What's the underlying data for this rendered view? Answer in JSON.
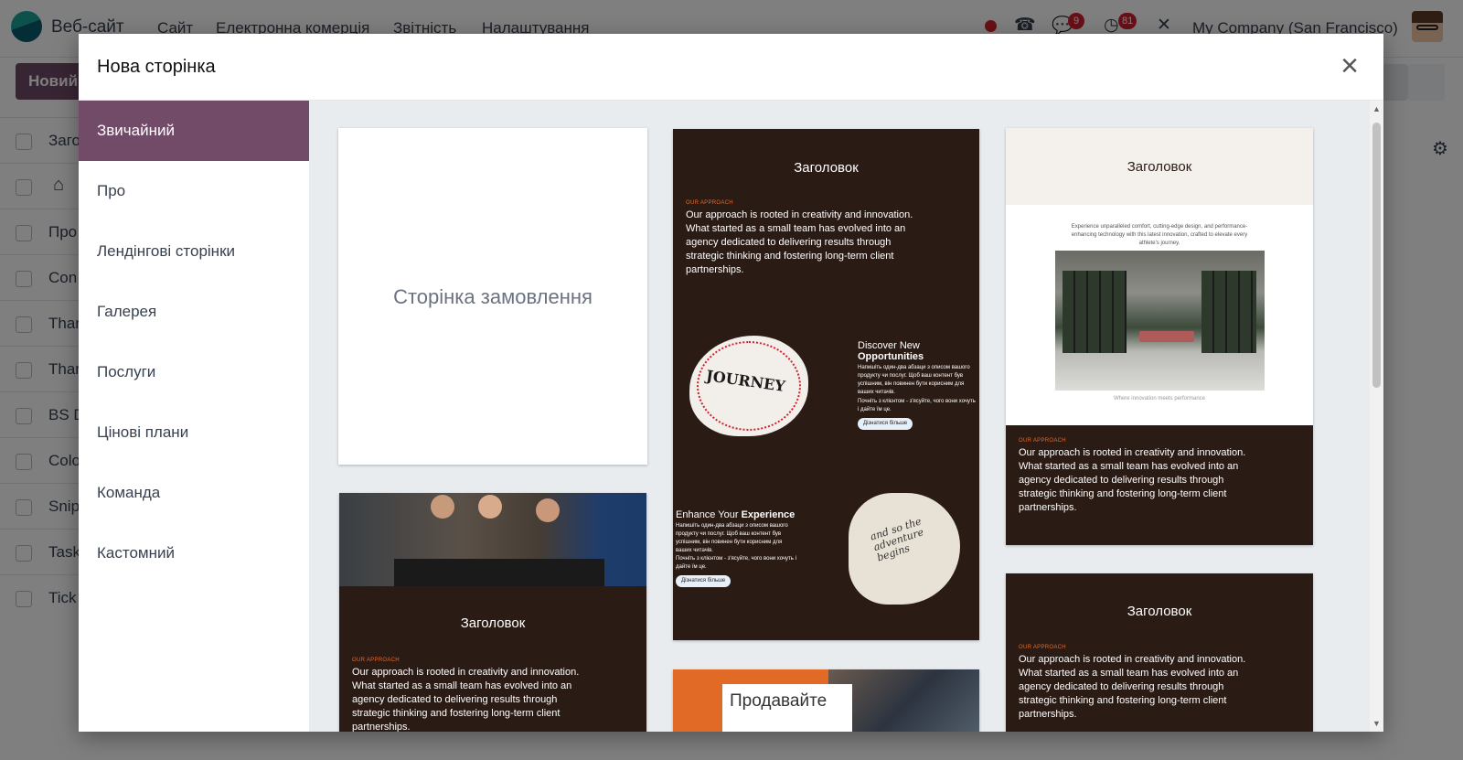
{
  "app": {
    "name": "Веб-сайт",
    "menu": [
      "Сайт",
      "Електронна комерція",
      "Звітність",
      "Налаштування"
    ],
    "messages_count": "9",
    "activities_count": "81",
    "company": "My Company (San Francisco)",
    "new_button": "Новий"
  },
  "background_list": {
    "rows": [
      "Заго",
      "",
      "Про",
      "Con",
      "Thar",
      "Thar",
      "BS D",
      "Colo",
      "Snip",
      "Task",
      "Tick"
    ]
  },
  "modal": {
    "title": "Нова сторінка",
    "categories": [
      {
        "label": "Звичайний",
        "active": true
      },
      {
        "label": "Про",
        "active": false
      },
      {
        "label": "Лендінгові сторінки",
        "active": false
      },
      {
        "label": "Галерея",
        "active": false
      },
      {
        "label": "Послуги",
        "active": false
      },
      {
        "label": "Цінові плани",
        "active": false
      },
      {
        "label": "Команда",
        "active": false
      },
      {
        "label": "Кастомний",
        "active": false
      }
    ],
    "blank_template_label": "Сторінка замовлення",
    "template_title": "Заголовок",
    "kicker": "OUR APPROACH",
    "approach_text": "Our approach is rooted in creativity and innovation. What started as a small team has evolved into an agency dedicated to delivering results through strategic thinking and fostering long-term client partnerships.",
    "feature1_heading_line1": "Discover New",
    "feature1_heading_line2": "Opportunities",
    "feature2_heading_normal": "Enhance Your ",
    "feature2_heading_bold": "Experience",
    "feature_text": "Напишіть один-два абзаци з описом вашого продукту чи послуг. Щоб ваш контент був успішним, він повинен бути корисним для ваших читачів.",
    "feature_text2": "Почніть з клієнтом - з'ясуйте, чого вони хочуть і дайте їм це.",
    "learn_more": "Дізнатися більше",
    "journey_text": "JOURNEY",
    "adventure_text": "and so the adventure begins",
    "intro_text": "Experience unparalleled comfort, cutting-edge design, and performance-enhancing technology with this latest innovation, crafted to elevate every athlete's journey.",
    "caption": "Where innovation meets performance",
    "sell_label": "Продавайте"
  },
  "colors": {
    "brand": "#714b67",
    "template_dark": "#2b1b15",
    "accent_orange": "#e26a2c",
    "badge_red": "#d2202f"
  }
}
